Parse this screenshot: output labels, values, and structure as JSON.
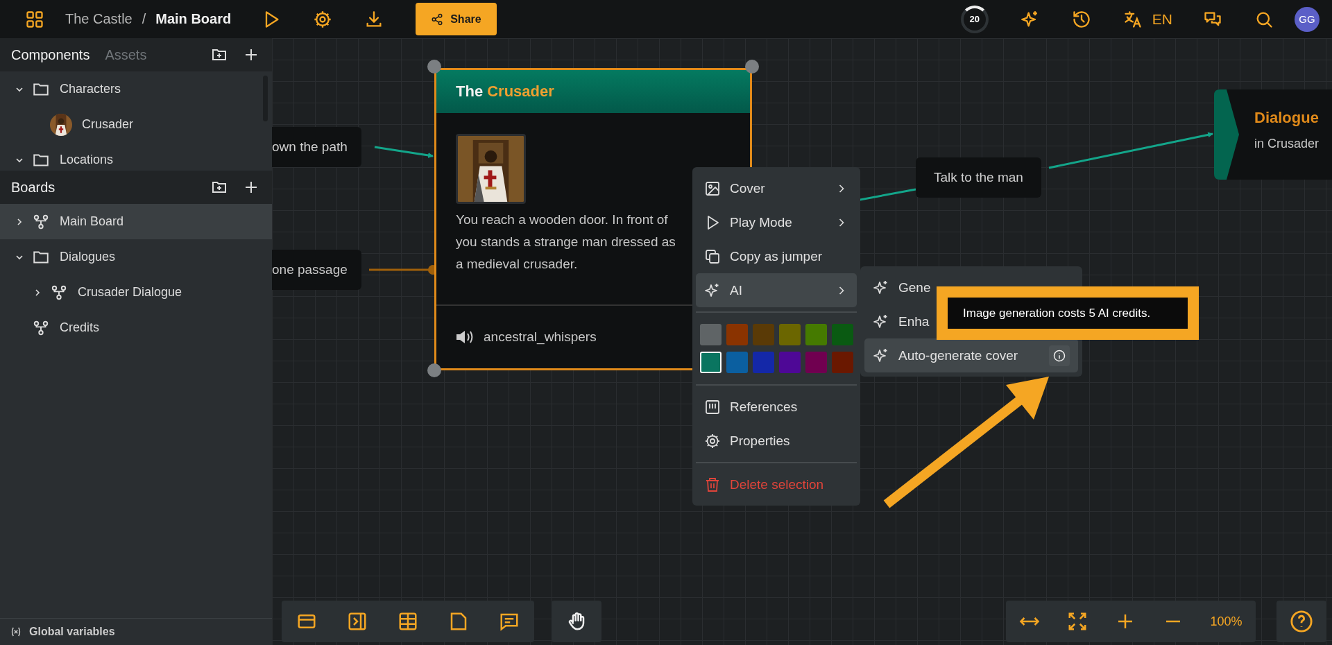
{
  "topbar": {
    "project": "The Castle",
    "separator": "/",
    "board": "Main Board",
    "share": "Share",
    "credits": "20",
    "language": "EN",
    "avatar": "GG"
  },
  "sidebar": {
    "tabs": [
      {
        "label": "Components",
        "selected": true
      },
      {
        "label": "Assets",
        "selected": false
      }
    ],
    "components": [
      {
        "label": "Characters",
        "kind": "folder",
        "expanded": true,
        "selected": false,
        "children": [
          {
            "label": "Crusader",
            "kind": "character",
            "selected": false
          }
        ]
      },
      {
        "label": "Locations",
        "kind": "folder",
        "expanded": true,
        "selected": false
      }
    ],
    "boards_title": "Boards",
    "boards": [
      {
        "label": "Main Board",
        "kind": "board",
        "expanded": false,
        "selected": true
      },
      {
        "label": "Dialogues",
        "kind": "folder",
        "expanded": true,
        "selected": false,
        "children": [
          {
            "label": "Crusader Dialogue",
            "kind": "board",
            "expanded": false,
            "selected": false
          }
        ]
      },
      {
        "label": "Credits",
        "kind": "board",
        "selected": false
      }
    ],
    "footer": "Global variables"
  },
  "canvas": {
    "edge_labels": [
      {
        "label": "own the path",
        "kind": "teal"
      },
      {
        "label": "one passage",
        "kind": "orange"
      },
      {
        "label": "Talk to the man",
        "kind": "teal"
      }
    ],
    "card": {
      "title": "The",
      "title_highlight": "Crusader",
      "text": "You reach a wooden door. In front of you stands a strange man dressed as a medieval crusader.",
      "audio": "ancestral_whispers"
    },
    "dialogue_node": {
      "title": "Dialogue",
      "subtitle": "in Crusader"
    },
    "context_menu": {
      "items": [
        {
          "label": "Cover",
          "submenu": true,
          "selected": false
        },
        {
          "label": "Play Mode",
          "submenu": true,
          "selected": false
        },
        {
          "label": "Copy as jumper",
          "submenu": false,
          "selected": false
        },
        {
          "label": "AI",
          "submenu": true,
          "selected": true
        }
      ],
      "colors": [
        {
          "color": "#5f6466",
          "selected": false
        },
        {
          "color": "#8a3300",
          "selected": false
        },
        {
          "color": "#5a3a06",
          "selected": false
        },
        {
          "color": "#6b6600",
          "selected": false
        },
        {
          "color": "#457a00",
          "selected": false
        },
        {
          "color": "#0a5a12",
          "selected": false
        },
        {
          "color": "#0a7560",
          "selected": true
        },
        {
          "color": "#0b5fa0",
          "selected": false
        },
        {
          "color": "#1428a8",
          "selected": false
        },
        {
          "color": "#4e0896",
          "selected": false
        },
        {
          "color": "#700050",
          "selected": false
        },
        {
          "color": "#6a1800",
          "selected": false
        }
      ],
      "lower_items": [
        {
          "label": "References"
        },
        {
          "label": "Properties"
        }
      ],
      "delete_label": "Delete selection"
    },
    "submenu": {
      "items": [
        {
          "label": "Gene",
          "selected": false
        },
        {
          "label": "Enha",
          "selected": false
        },
        {
          "label": "Auto-generate cover",
          "selected": true,
          "info": true
        }
      ]
    },
    "tooltip": "Image generation costs 5 AI credits.",
    "zoom": "100%"
  }
}
